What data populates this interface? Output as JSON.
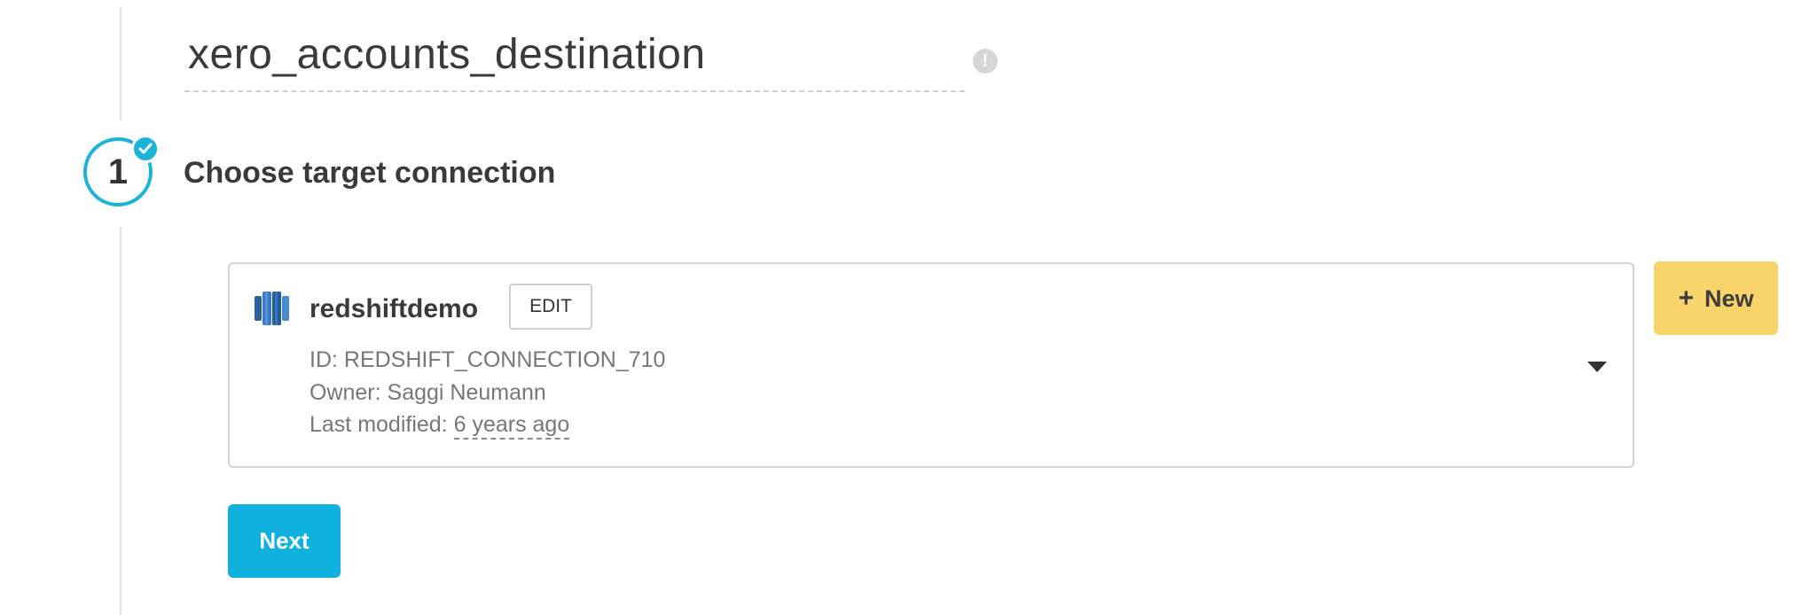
{
  "destination": {
    "name": "xero_accounts_destination",
    "warning_icon": "exclamation-icon"
  },
  "step": {
    "number": "1",
    "title": "Choose target connection",
    "completed": true,
    "accent_color": "#1bb4d8"
  },
  "connection": {
    "icon": "redshift-database-icon",
    "name": "redshiftdemo",
    "edit_label": "EDIT",
    "id_line": "ID: REDSHIFT_CONNECTION_710",
    "owner_line": "Owner: Saggi Neumann",
    "modified_label": "Last modified:",
    "modified_value": "6 years ago",
    "dropdown_icon": "caret-down-icon"
  },
  "actions": {
    "new_plus": "+",
    "new_label": "New",
    "new_color": "#f9d46b",
    "next_label": "Next",
    "next_color": "#0fb2df"
  }
}
